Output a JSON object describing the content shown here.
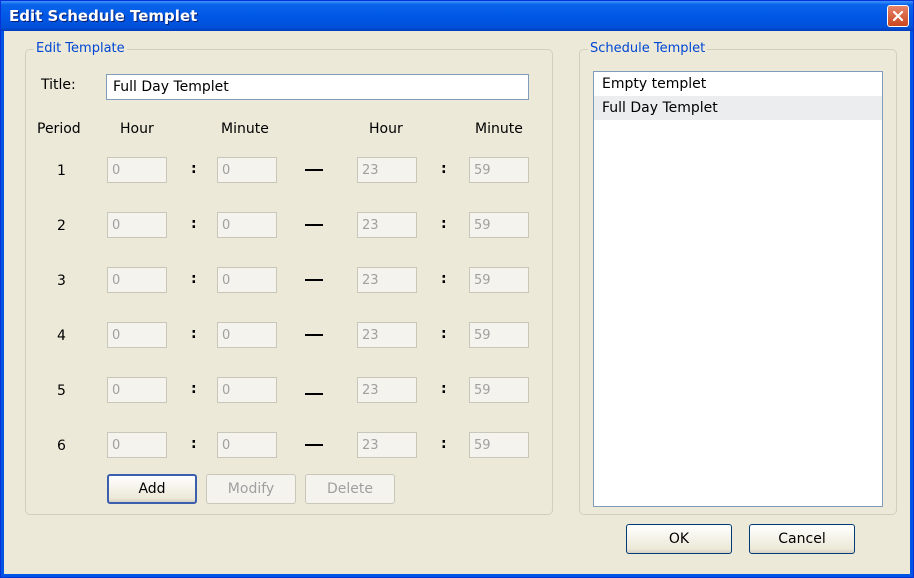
{
  "window": {
    "title": "Edit Schedule Templet"
  },
  "edit_group": {
    "legend": "Edit Template",
    "title_label": "Title:",
    "title_value": "Full Day Templet",
    "headers": {
      "period": "Period",
      "hour_start": "Hour",
      "minute_start": "Minute",
      "hour_end": "Hour",
      "minute_end": "Minute"
    },
    "periods": [
      {
        "num": "1",
        "h1": "0",
        "m1": "0",
        "h2": "23",
        "m2": "59"
      },
      {
        "num": "2",
        "h1": "0",
        "m1": "0",
        "h2": "23",
        "m2": "59"
      },
      {
        "num": "3",
        "h1": "0",
        "m1": "0",
        "h2": "23",
        "m2": "59"
      },
      {
        "num": "4",
        "h1": "0",
        "m1": "0",
        "h2": "23",
        "m2": "59"
      },
      {
        "num": "5",
        "h1": "0",
        "m1": "0",
        "h2": "23",
        "m2": "59"
      },
      {
        "num": "6",
        "h1": "0",
        "m1": "0",
        "h2": "23",
        "m2": "59"
      }
    ],
    "separator": ":",
    "buttons": {
      "add": "Add",
      "modify": "Modify",
      "delete": "Delete"
    }
  },
  "schedule_group": {
    "legend": "Schedule Templet",
    "items": [
      {
        "label": "Empty templet",
        "selected": false
      },
      {
        "label": "Full Day Templet",
        "selected": true
      }
    ]
  },
  "footer": {
    "ok": "OK",
    "cancel": "Cancel"
  },
  "colors": {
    "titlebar": "#0058e6",
    "legend_text": "#0046d5",
    "close_button": "#c9461f"
  },
  "icons": {
    "close": "close-icon"
  }
}
